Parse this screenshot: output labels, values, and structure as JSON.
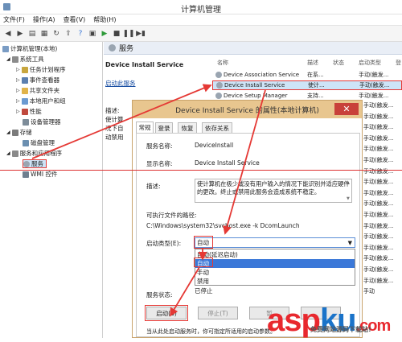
{
  "window": {
    "title": "计算机管理"
  },
  "menu": [
    "文件(F)",
    "操作(A)",
    "查看(V)",
    "帮助(H)"
  ],
  "tree": {
    "root": "计算机管理(本地)",
    "items": [
      "系统工具",
      "任务计划程序",
      "事件查看器",
      "共享文件夹",
      "本地用户和组",
      "性能",
      "设备管理器",
      "存储",
      "磁盘管理",
      "服务和应用程序",
      "服务",
      "WMI 控件"
    ]
  },
  "services": {
    "header": "服务",
    "selected_name": "Device Install Service",
    "start_link": "启动此服务",
    "desc_label": "描述:",
    "desc_lines": [
      "使计算",
      "况下自",
      "动禁用"
    ],
    "columns": [
      "名称",
      "描述",
      "状态",
      "启动类型",
      "登"
    ],
    "rows": [
      {
        "name": "Device Association Service",
        "desc": "在系...",
        "status": "",
        "startup": "手动(触发...",
        "logon": "本"
      },
      {
        "name": "Device Install Service",
        "desc": "使计...",
        "status": "",
        "startup": "手动(触发...",
        "logon": "本"
      },
      {
        "name": "Device Setup Manager",
        "desc": "支持...",
        "status": "",
        "startup": "手动(触发...",
        "logon": "本"
      }
    ],
    "right_col_values": [
      "手动(触发...",
      "手动(触发...",
      "手动(触发...",
      "手动(触发...",
      "手动(触发...",
      "手动(触发...",
      "手动(触发...",
      "手动(触发...",
      "手动(触发...",
      "手动(触发...",
      "手动(触发...",
      "手动(触发...",
      "手动(触发...",
      "手动(触发...",
      "手动(触发...",
      "手动(触发...",
      "手动(触发...",
      "手动"
    ],
    "right_col2": [
      "本",
      "本",
      "本",
      "本",
      "本",
      "本",
      "本",
      "本",
      "本",
      "本",
      "本",
      "本",
      "本",
      "本",
      "本",
      "本",
      "本",
      "本"
    ]
  },
  "dialog": {
    "title": "Device Install Service 的属性(本地计算机)",
    "close": "✕",
    "tabs": [
      "常规",
      "登录",
      "恢复",
      "依存关系"
    ],
    "service_name_label": "服务名称:",
    "service_name": "DeviceInstall",
    "display_name_label": "显示名称:",
    "display_name": "Device Install Service",
    "description_label": "描述:",
    "description": "使计算机在极少或没有用户输入的情况下能识别并适应硬件的更改。终止或禁用此服务会造成系统不稳定。",
    "exe_path_label": "可执行文件的路径:",
    "exe_path": "C:\\Windows\\system32\\svchost.exe -k DcomLaunch",
    "startup_type_label": "启动类型(E):",
    "startup_type_value": "自动",
    "startup_options": [
      "自动(延迟启动)",
      "自动",
      "手动",
      "禁用"
    ],
    "highlighted_option": "自动",
    "service_status_label": "服务状态:",
    "service_status": "已停止",
    "buttons": {
      "start": "启动(S)",
      "stop": "停止(T)",
      "pause": "暂",
      "resume": ""
    },
    "hint": "当从此处启动服务时，你可指定所适用的启动参数。"
  },
  "watermark": {
    "brand_a": "asp",
    "brand_b": "ku",
    "brand_c": ".com",
    "sub": "免费网站源码下载站!"
  },
  "colors": {
    "annotation": "#e53935",
    "accent": "#3b78d8"
  }
}
